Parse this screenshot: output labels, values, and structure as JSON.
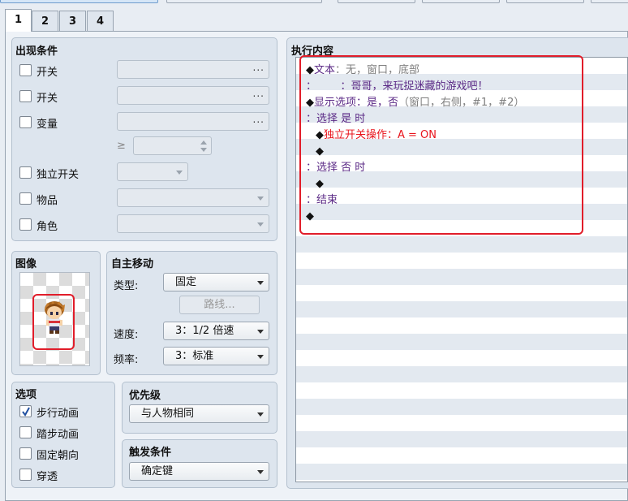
{
  "tabs": [
    "1",
    "2",
    "3",
    "4"
  ],
  "conditions": {
    "title": "出现条件",
    "switch1_label": "开关",
    "switch2_label": "开关",
    "variable_label": "变量",
    "gte_symbol": "≥",
    "self_switch_label": "独立开关",
    "item_label": "物品",
    "actor_label": "角色",
    "ellipsis": "..."
  },
  "image": {
    "title": "图像"
  },
  "autonomous": {
    "title": "自主移动",
    "type_label": "类型:",
    "type_value": "固定",
    "route_button": "路线...",
    "speed_label": "速度:",
    "speed_value": "3：1/2 倍速",
    "freq_label": "频率:",
    "freq_value": "3：标准"
  },
  "options": {
    "title": "选项",
    "walking": "步行动画",
    "stepping": "踏步动画",
    "direction_fix": "固定朝向",
    "through": "穿透",
    "walking_checked": true
  },
  "priority": {
    "title": "优先级",
    "value": "与人物相同"
  },
  "trigger": {
    "title": "触发条件",
    "value": "确定键"
  },
  "contents": {
    "title": "执行内容",
    "l1_cmd": "文本",
    "l1_args": "：无，窗口，底部",
    "l2_prefix": "：",
    "l2_text": "：哥哥，来玩捉迷藏的游戏吧！",
    "l3_cmd": "显示选项：是，否",
    "l3_args": "（窗口，右侧，#1，#2）",
    "l4": "：选择 是 时",
    "l5": "独立开关操作：A = ON",
    "l7": "：选择 否 时",
    "l9": "：结束"
  },
  "colors": {
    "annotation": "#e11d2a",
    "command": "#5b2a86",
    "selfswitch": "#e8141c"
  }
}
